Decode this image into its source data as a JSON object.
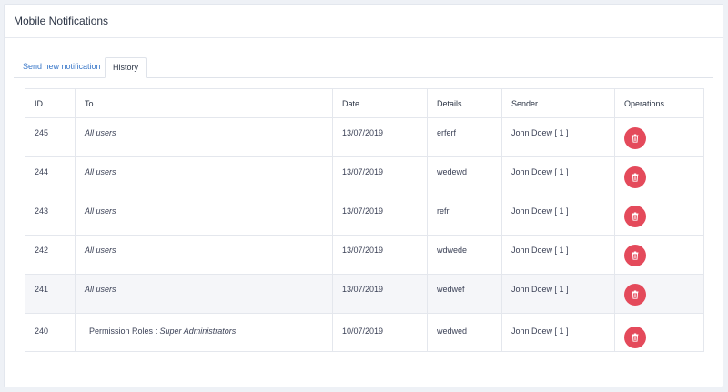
{
  "header": {
    "title": "Mobile Notifications"
  },
  "tabs": [
    {
      "label": "Send new notification",
      "active": false
    },
    {
      "label": "History",
      "active": true
    }
  ],
  "table": {
    "columns": [
      "ID",
      "To",
      "Date",
      "Details",
      "Sender",
      "Operations"
    ],
    "rows": [
      {
        "id": "245",
        "to": "All users",
        "date": "13/07/2019",
        "details": "erferf",
        "sender": "John Doew [ 1 ]"
      },
      {
        "id": "244",
        "to": "All users",
        "date": "13/07/2019",
        "details": "wedewd",
        "sender": "John Doew [ 1 ]"
      },
      {
        "id": "243",
        "to": "All users",
        "date": "13/07/2019",
        "details": "refr",
        "sender": "John Doew [ 1 ]"
      },
      {
        "id": "242",
        "to": "All users",
        "date": "13/07/2019",
        "details": "wdwede",
        "sender": "John Doew [ 1 ]"
      },
      {
        "id": "241",
        "to": "All users",
        "date": "13/07/2019",
        "details": "wedwef",
        "sender": "John Doew [ 1 ]"
      },
      {
        "id": "240",
        "to_prefix": "Permission Roles : ",
        "to": "Super Administrators",
        "date": "10/07/2019",
        "details": "wedwed",
        "sender": "John Doew [ 1 ]"
      }
    ]
  },
  "icons": {
    "delete": "trash-icon"
  },
  "colors": {
    "delete_button": "#e44a5b",
    "active_link": "#3a78c9",
    "highlight_row": "#f5f6f9"
  }
}
